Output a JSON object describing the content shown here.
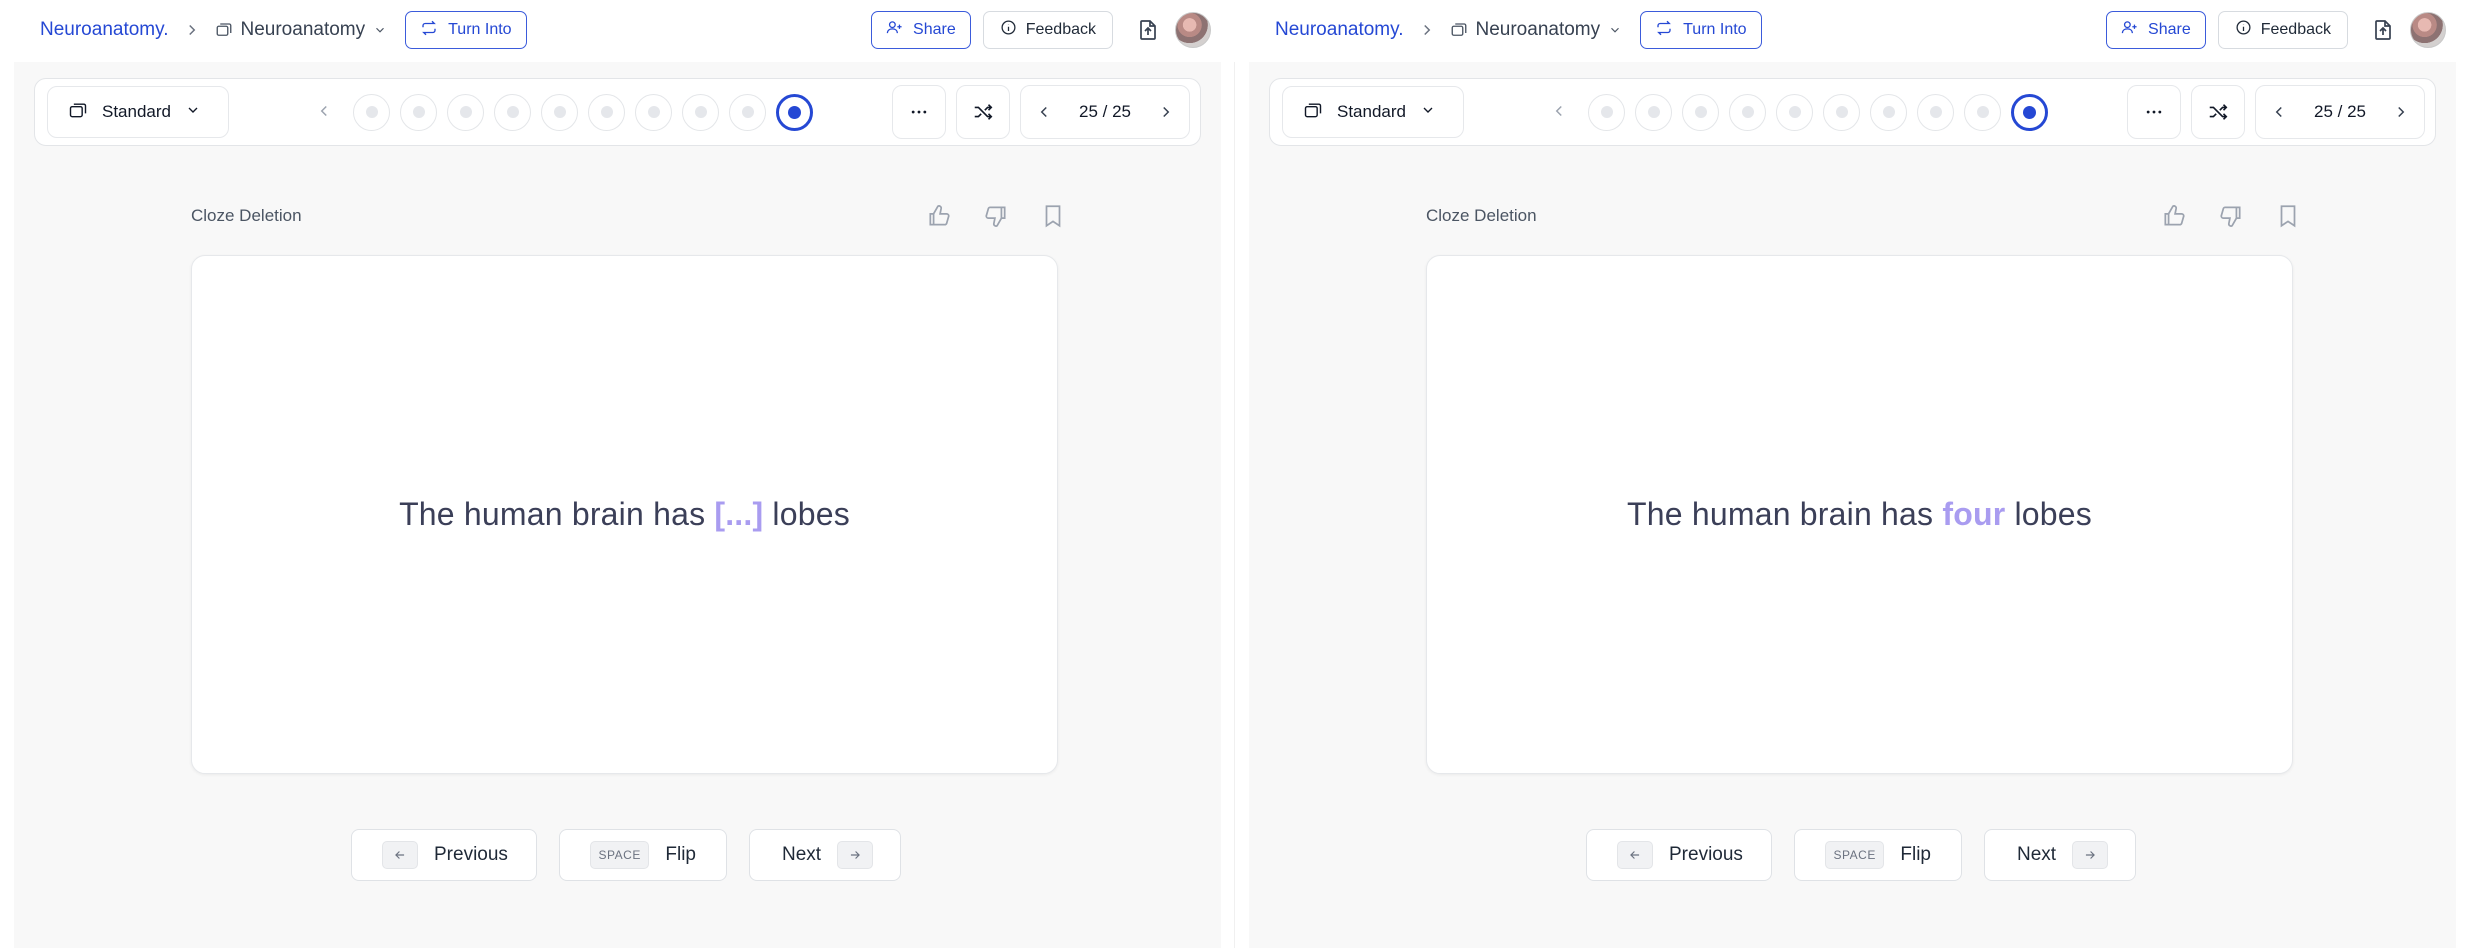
{
  "panels": [
    {
      "breadcrumb": {
        "brand": "Neuroanatomy.",
        "deck": "Neuroanatomy"
      },
      "header": {
        "turn_into": "Turn Into",
        "share": "Share",
        "feedback": "Feedback"
      },
      "toolbar": {
        "mode": "Standard",
        "progress_current": 25,
        "progress_total": 25,
        "counter": "25 / 25"
      },
      "card": {
        "type_label": "Cloze Deletion",
        "before": "The human brain has ",
        "blank": "[...]",
        "after": " lobes"
      },
      "bottom_nav": {
        "previous": "Previous",
        "space_key": "SPACE",
        "flip": "Flip",
        "next": "Next"
      }
    },
    {
      "breadcrumb": {
        "brand": "Neuroanatomy.",
        "deck": "Neuroanatomy"
      },
      "header": {
        "turn_into": "Turn Into",
        "share": "Share",
        "feedback": "Feedback"
      },
      "toolbar": {
        "mode": "Standard",
        "progress_current": 25,
        "progress_total": 25,
        "counter": "25 / 25"
      },
      "card": {
        "type_label": "Cloze Deletion",
        "before": "The human brain has ",
        "answer": "four",
        "after": " lobes"
      },
      "bottom_nav": {
        "previous": "Previous",
        "space_key": "SPACE",
        "flip": "Flip",
        "next": "Next"
      }
    }
  ],
  "colors": {
    "accent": "#2548d4",
    "cloze": "#a99cf0",
    "background": "#f8f8f8"
  },
  "icons": [
    "chevron-right-icon",
    "deck-icon",
    "chevron-down-icon",
    "turn-into-icon",
    "share-user-icon",
    "info-icon",
    "upload-file-icon",
    "card-stack-icon",
    "chevron-left-icon",
    "more-icon",
    "shuffle-icon",
    "thumbs-up-icon",
    "thumbs-down-icon",
    "bookmark-icon",
    "arrow-left-icon",
    "arrow-right-icon"
  ]
}
